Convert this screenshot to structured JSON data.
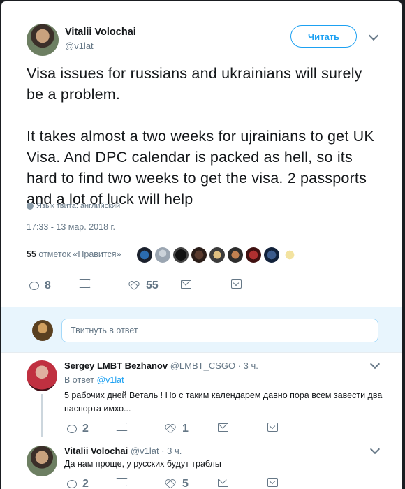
{
  "tweet": {
    "author_name": "Vitalii Volochai",
    "author_handle": "@v1lat",
    "follow_label": "Читать",
    "text": "Visa issues for russians and ukrainians will surely be a problem.\n\nIt takes almost a two weeks for ujrainians to get UK Visa. And DPC calendar is packed as hell, so its hard to find two weeks to get the visa. 2 passports and a lot of luck will help",
    "language_note": "Язык твита: английский",
    "timestamp": "17:33 - 13 мар. 2018 г.",
    "likes_count": "55",
    "likes_label": "отметок «Нравится»",
    "reply_count": "8",
    "like_count": "55"
  },
  "reply_composer": {
    "placeholder": "Твитнуть в ответ"
  },
  "replies": [
    {
      "author_name": "Sergey LMBT Bezhanov",
      "author_handle": "@LMBT_CSGO",
      "time": "· 3 ч.",
      "reply_to_prefix": "В ответ",
      "reply_to_mention": "@v1lat",
      "text": "5 рабочих дней Веталь ! Но с таким календарем давно пора всем завести два паспорта имхо...",
      "reply_count": "2",
      "like_count": "1"
    },
    {
      "author_name": "Vitalii Volochai",
      "author_handle": "@v1lat",
      "time": "· 3 ч.",
      "text": "Да нам проще, у русских будут траблы",
      "reply_count": "2",
      "like_count": "5"
    }
  ],
  "colors": {
    "accent": "#1da1f2",
    "muted": "#657786",
    "reply_bar": "#e8f5fd"
  }
}
